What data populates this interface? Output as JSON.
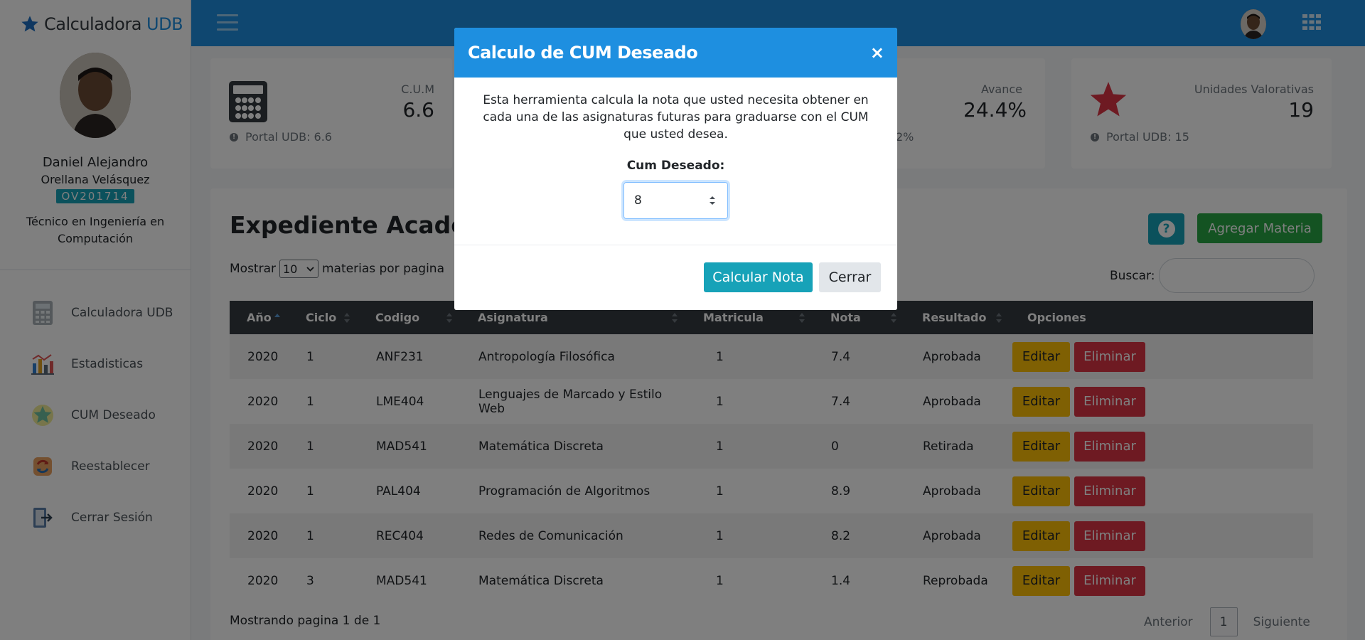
{
  "brand": {
    "name": "Calculadora ",
    "accent": "UDB"
  },
  "user": {
    "first_name": "Daniel Alejandro",
    "last_name": "Orellana Velásquez",
    "code": "OV201714",
    "career": "Técnico en Ingeniería en Computación"
  },
  "menu": [
    {
      "label": "Calculadora UDB",
      "icon": "calculator-icon"
    },
    {
      "label": "Estadisticas",
      "icon": "bar-chart-icon"
    },
    {
      "label": "CUM Deseado",
      "icon": "star-badge-icon"
    },
    {
      "label": "Reestablecer",
      "icon": "refresh-icon"
    },
    {
      "label": "Cerrar Sesión",
      "icon": "logout-icon"
    }
  ],
  "stats": {
    "cum": {
      "title": "C.U.M",
      "value": "6.6",
      "foot": "Portal UDB: 6.6"
    },
    "avance": {
      "title": "Avance",
      "value": "24.4%",
      "foot": "2%"
    },
    "uv": {
      "title": "Unidades Valorativas",
      "value": "19",
      "foot": "Portal UDB: 15"
    }
  },
  "main": {
    "title": "Expediente Academ",
    "add_label": "Agregar Materia",
    "show_label": "Mostrar",
    "page_size": "10",
    "per_page_label": "materias por pagina",
    "search_label": "Buscar:",
    "search_value": "",
    "columns": [
      "Año",
      "Ciclo",
      "Codigo",
      "Asignatura",
      "Matricula",
      "Nota",
      "Resultado",
      "Opciones"
    ],
    "rows": [
      {
        "anio": "2020",
        "ciclo": "1",
        "codigo": "ANF231",
        "asignatura": "Antropología Filosófica",
        "matricula": "1",
        "nota": "7.4",
        "resultado": "Aprobada"
      },
      {
        "anio": "2020",
        "ciclo": "1",
        "codigo": "LME404",
        "asignatura": "Lenguajes de Marcado y Estilo Web",
        "matricula": "1",
        "nota": "7.4",
        "resultado": "Aprobada"
      },
      {
        "anio": "2020",
        "ciclo": "1",
        "codigo": "MAD541",
        "asignatura": "Matemática Discreta",
        "matricula": "1",
        "nota": "0",
        "resultado": "Retirada"
      },
      {
        "anio": "2020",
        "ciclo": "1",
        "codigo": "PAL404",
        "asignatura": "Programación de Algoritmos",
        "matricula": "1",
        "nota": "8.9",
        "resultado": "Aprobada"
      },
      {
        "anio": "2020",
        "ciclo": "1",
        "codigo": "REC404",
        "asignatura": "Redes de Comunicación",
        "matricula": "1",
        "nota": "8.2",
        "resultado": "Aprobada"
      },
      {
        "anio": "2020",
        "ciclo": "3",
        "codigo": "MAD541",
        "asignatura": "Matemática Discreta",
        "matricula": "1",
        "nota": "1.4",
        "resultado": "Reprobada"
      }
    ],
    "edit_label": "Editar",
    "delete_label": "Eliminar",
    "footer_info": "Mostrando pagina 1 de 1",
    "pager": {
      "prev": "Anterior",
      "current": "1",
      "next": "Siguiente"
    }
  },
  "modal": {
    "title": "Calculo de CUM Deseado",
    "close_glyph": "×",
    "description": "Esta herramienta calcula la nota que usted necesita obtener en cada una de las asignaturas futuras para graduarse con el CUM que usted desea.",
    "field_label": "Cum Deseado:",
    "field_value": "8",
    "calc_label": "Calcular Nota",
    "close_label": "Cerrar"
  },
  "colors": {
    "primary": "#1e8fe0",
    "info": "#17a2b8",
    "success": "#28a745",
    "warning": "#ffc107",
    "danger": "#dc3545",
    "dark": "#343a40"
  }
}
